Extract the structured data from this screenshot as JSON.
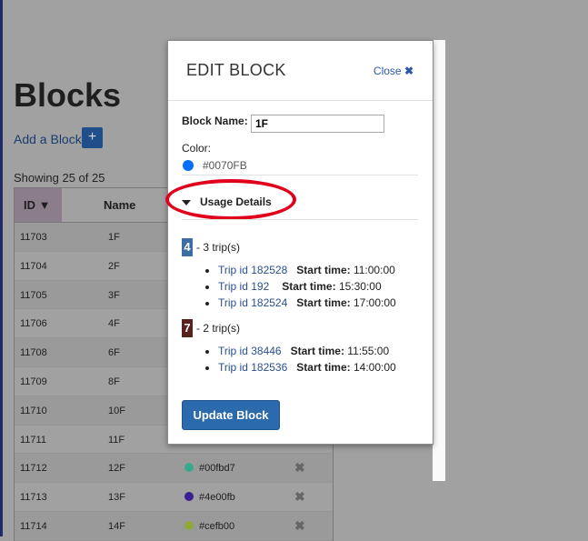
{
  "page": {
    "title": "Blocks",
    "add_label": "Add a Block",
    "add_button": "+",
    "showing": "Showing 25 of 25",
    "col_id": "ID",
    "col_name": "Name"
  },
  "rows": [
    {
      "id": "11703",
      "name": "1F",
      "color": "",
      "dot": ""
    },
    {
      "id": "11704",
      "name": "2F",
      "color": "",
      "dot": ""
    },
    {
      "id": "11705",
      "name": "3F",
      "color": "",
      "dot": ""
    },
    {
      "id": "11706",
      "name": "4F",
      "color": "",
      "dot": ""
    },
    {
      "id": "11708",
      "name": "6F",
      "color": "",
      "dot": ""
    },
    {
      "id": "11709",
      "name": "8F",
      "color": "",
      "dot": ""
    },
    {
      "id": "11710",
      "name": "10F",
      "color": "",
      "dot": ""
    },
    {
      "id": "11711",
      "name": "11F",
      "color": "",
      "dot": ""
    },
    {
      "id": "11712",
      "name": "12F",
      "color": "#00fbd7",
      "dot": "#3aa88e"
    },
    {
      "id": "11713",
      "name": "13F",
      "color": "#4e00fb",
      "dot": "#3b1e8f"
    },
    {
      "id": "11714",
      "name": "14F",
      "color": "#cefb00",
      "dot": "#8fa83a"
    }
  ],
  "modal": {
    "title": "EDIT BLOCK",
    "close_label": "Close",
    "close_icon": "✖",
    "block_name_label": "Block Name:",
    "block_name_value": "1F",
    "color_label": "Color:",
    "color_value": "#0070FB",
    "usage_label": "Usage Details",
    "groups": [
      {
        "badge": "4",
        "badge_color": "#3a6ea5",
        "count_text": "- 3 trip(s)",
        "trips": [
          {
            "link": "Trip id 182528",
            "start_label": "Start time:",
            "time": "11:00:00"
          },
          {
            "link": "Trip id 192",
            "start_label": "Start time:",
            "time": "15:30:00"
          },
          {
            "link": "Trip id 182524",
            "start_label": "Start time:",
            "time": "17:00:00"
          }
        ]
      },
      {
        "badge": "7",
        "badge_color": "#5a1f1f",
        "count_text": "- 2 trip(s)",
        "trips": [
          {
            "link": "Trip id 38446",
            "start_label": "Start time:",
            "time": "11:55:00"
          },
          {
            "link": "Trip id 182536",
            "start_label": "Start time:",
            "time": "14:00:00"
          }
        ]
      }
    ],
    "update_label": "Update Block"
  }
}
